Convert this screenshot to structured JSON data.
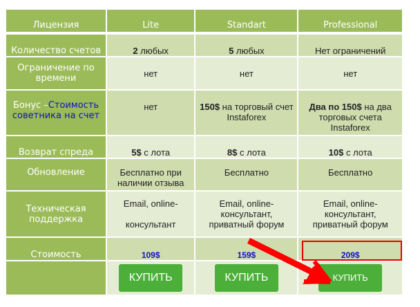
{
  "header": {
    "license": "Лицензия",
    "plans": [
      "Lite",
      "Standart",
      "Professional"
    ]
  },
  "rows": [
    {
      "label": "Количество счетов",
      "cells": [
        {
          "b": "2",
          "t": " любых"
        },
        {
          "b": "5",
          "t": " любых"
        },
        {
          "b": "",
          "t": "Нет ограничений"
        }
      ]
    },
    {
      "label": "Ограничение по времени",
      "cells": [
        {
          "b": "",
          "t": "нет"
        },
        {
          "b": "",
          "t": "нет"
        },
        {
          "b": "",
          "t": "нет"
        }
      ]
    },
    {
      "label_pre": "Бонус –",
      "label_link": "Стоимость советника на счет",
      "cells": [
        {
          "b": "",
          "t": "нет"
        },
        {
          "b": "150$",
          "t": " на торговый счет Instaforex"
        },
        {
          "b": "Два по 150$",
          "t": " на два торговых счета Instaforex"
        }
      ]
    },
    {
      "label": "Возврат спреда",
      "cells": [
        {
          "b": "5$",
          "t": " с лота"
        },
        {
          "b": "8$",
          "t": " с лота"
        },
        {
          "b": "10$",
          "t": " с лота"
        }
      ]
    },
    {
      "label": "Обновление",
      "cells": [
        {
          "b": "",
          "t": "Бесплатно при наличии отзыва"
        },
        {
          "b": "",
          "t": "Бесплатно"
        },
        {
          "b": "",
          "t": "Бесплатно"
        }
      ]
    },
    {
      "label": "Техническая поддержка",
      "cells": [
        {
          "b": "",
          "t": "Email, online-консультант"
        },
        {
          "b": "",
          "t": "Email, online-консультант, приватный форум"
        },
        {
          "b": "",
          "t": "Email, online-консультант, приватный форум"
        }
      ]
    }
  ],
  "price": {
    "label": "Стоимость",
    "values": [
      "109$",
      "159$",
      "209$"
    ]
  },
  "buy_label": "КУПИТЬ",
  "colors": {
    "header": "#9bbb59",
    "row_odd": "#cfdcae",
    "row_even": "#e5ecd4",
    "button": "#4caf3a",
    "highlight": "#e30000"
  }
}
